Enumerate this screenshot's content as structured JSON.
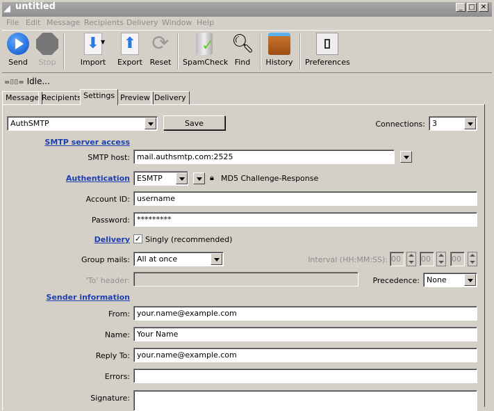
{
  "window": {
    "title": "untitled",
    "min": "_",
    "max": "□",
    "close": "✕"
  },
  "menu": [
    "File",
    "Edit",
    "Message",
    "Recipients",
    "Delivery",
    "Window",
    "Help"
  ],
  "toolbar": {
    "send": "Send",
    "stop": "Stop",
    "import": "Import",
    "export": "Export",
    "reset": "Reset",
    "spamcheck": "SpamCheck",
    "find": "Find",
    "history": "History",
    "preferences": "Preferences"
  },
  "status": "Idle...",
  "tabs": [
    "Message",
    "Recipients",
    "Settings",
    "Preview",
    "Delivery"
  ],
  "active_tab": "Settings",
  "settings": {
    "profile": "AuthSMTP",
    "save": "Save",
    "connections_label": "Connections:",
    "connections": "3",
    "smtp_section": "SMTP server access",
    "smtp_host_label": "SMTP host:",
    "smtp_host": "mail.authsmtp.com:2525",
    "auth_link": "Authentication",
    "auth_method": "ESMTP",
    "auth_type": "MD5 Challenge-Response",
    "account_label": "Account ID:",
    "account": "username",
    "password_label": "Password:",
    "password": "*********",
    "delivery_link": "Delivery",
    "singly": "Singly (recommended)",
    "singly_checked": true,
    "group_label": "Group mails:",
    "group": "All at once",
    "interval_label": "Interval (HH:MM:SS):",
    "hh": "00",
    "mm": "00",
    "ss": "00",
    "to_label": "'To' header:",
    "to": "",
    "precedence_label": "Precedence:",
    "precedence": "None",
    "sender_section": "Sender information",
    "from_label": "From:",
    "from": "your.name@example.com",
    "name_label": "Name:",
    "name": "Your Name",
    "reply_label": "Reply To:",
    "reply": "your.name@example.com",
    "errors_label": "Errors:",
    "errors": "",
    "signature_label": "Signature:",
    "signature": ""
  }
}
